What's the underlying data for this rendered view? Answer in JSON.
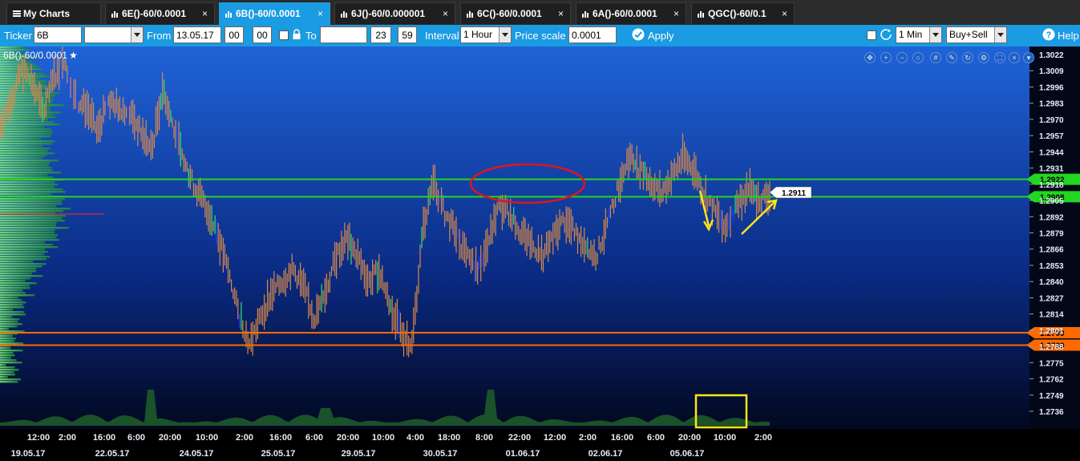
{
  "tabs": [
    {
      "label": "My Charts",
      "active": false
    },
    {
      "label": "6E()-60/0.0001",
      "active": false
    },
    {
      "label": "6B()-60/0.0001",
      "active": true
    },
    {
      "label": "6J()-60/0.000001",
      "active": false
    },
    {
      "label": "6C()-60/0.0001",
      "active": false
    },
    {
      "label": "6A()-60/0.0001",
      "active": false
    },
    {
      "label": "QGC()-60/0.1",
      "active": false
    }
  ],
  "tab_close_glyph": "×",
  "toolbar": {
    "ticker_label": "Ticker",
    "ticker_value": "6B",
    "from_label": "From",
    "from_date": "13.05.17",
    "from_hour": "00",
    "from_min": "00",
    "to_label": "To",
    "to_date": "",
    "to_hour": "23",
    "to_min": "59",
    "interval_label": "Interval",
    "interval_value": "1 Hour",
    "price_scale_label": "Price scale",
    "price_scale_value": "0.0001",
    "apply_label": "Apply",
    "period_value": "1 Min",
    "mode_value": "Buy+Sell",
    "help_label": "Help"
  },
  "chart_title": "6B()-60/0.0001",
  "chart_title_star": "★",
  "colors": {
    "accent": "#1a9be2",
    "bar": "#d98a4a",
    "green_level": "#22d622",
    "orange_level": "#ff6a00",
    "annotation_red": "#e0141e",
    "annotation_yellow": "#ffe516"
  },
  "chart_data": {
    "type": "bar",
    "y_ticks": [
      "1.3022",
      "1.3009",
      "1.2996",
      "1.2983",
      "1.2970",
      "1.2957",
      "1.2944",
      "1.2931",
      "1.2918",
      "1.2905",
      "1.2892",
      "1.2879",
      "1.2866",
      "1.2853",
      "1.2840",
      "1.2827",
      "1.2814",
      "1.2801",
      "1.2788",
      "1.2775",
      "1.2762",
      "1.2749",
      "1.2736"
    ],
    "ylim": [
      1.2726,
      1.3025
    ],
    "x_time_labels": [
      "12:00",
      "2:00",
      "16:00",
      "6:00",
      "20:00",
      "10:00",
      "2:00",
      "16:00",
      "6:00",
      "20:00",
      "10:00",
      "4:00",
      "18:00",
      "8:00",
      "22:00",
      "12:00",
      "2:00",
      "16:00",
      "6:00",
      "20:00",
      "10:00",
      "2:00"
    ],
    "x_date_labels": [
      "19.05.17",
      "22.05.17",
      "24.05.17",
      "25.05.17",
      "29.05.17",
      "30.05.17",
      "01.06.17",
      "02.06.17",
      "05.06.17"
    ],
    "price_levels": [
      {
        "label": "1.2922",
        "value": 1.2922,
        "color": "green"
      },
      {
        "label": "1.2908",
        "value": 1.2908,
        "color": "green"
      },
      {
        "label": "1.2799",
        "value": 1.2799,
        "color": "orange"
      },
      {
        "label": "1.2789",
        "value": 1.2789,
        "color": "orange"
      }
    ],
    "last_price": "1.2911",
    "close_path": [
      [
        1,
        1.2965
      ],
      [
        2,
        1.2985
      ],
      [
        3,
        1.301
      ],
      [
        4,
        1.3
      ],
      [
        5,
        1.2975
      ],
      [
        6,
        1.3005
      ],
      [
        7,
        1.3015
      ],
      [
        8,
        1.2985
      ],
      [
        9,
        1.298
      ],
      [
        10,
        1.296
      ],
      [
        11,
        1.2985
      ],
      [
        12,
        1.298
      ],
      [
        13,
        1.2975
      ],
      [
        14,
        1.296
      ],
      [
        15,
        1.2945
      ],
      [
        16,
        1.2995
      ],
      [
        17,
        1.2965
      ],
      [
        18,
        1.2935
      ],
      [
        19,
        1.2915
      ],
      [
        20,
        1.29
      ],
      [
        21,
        1.288
      ],
      [
        22,
        1.285
      ],
      [
        23,
        1.2815
      ],
      [
        24,
        1.279
      ],
      [
        25,
        1.281
      ],
      [
        26,
        1.283
      ],
      [
        27,
        1.284
      ],
      [
        28,
        1.285
      ],
      [
        29,
        1.2835
      ],
      [
        30,
        1.281
      ],
      [
        31,
        1.283
      ],
      [
        32,
        1.286
      ],
      [
        33,
        1.2875
      ],
      [
        34,
        1.286
      ],
      [
        35,
        1.284
      ],
      [
        36,
        1.285
      ],
      [
        37,
        1.282
      ],
      [
        38,
        1.28
      ],
      [
        39,
        1.279
      ],
      [
        40,
        1.288
      ],
      [
        41,
        1.292
      ],
      [
        42,
        1.2895
      ],
      [
        43,
        1.288
      ],
      [
        44,
        1.286
      ],
      [
        45,
        1.285
      ],
      [
        46,
        1.287
      ],
      [
        47,
        1.29
      ],
      [
        48,
        1.2895
      ],
      [
        49,
        1.288
      ],
      [
        50,
        1.287
      ],
      [
        51,
        1.286
      ],
      [
        52,
        1.2875
      ],
      [
        53,
        1.289
      ],
      [
        54,
        1.288
      ],
      [
        55,
        1.287
      ],
      [
        56,
        1.286
      ],
      [
        57,
        1.2885
      ],
      [
        58,
        1.2915
      ],
      [
        59,
        1.294
      ],
      [
        60,
        1.293
      ],
      [
        61,
        1.292
      ],
      [
        62,
        1.291
      ],
      [
        63,
        1.2925
      ],
      [
        64,
        1.294
      ],
      [
        65,
        1.293
      ],
      [
        66,
        1.291
      ],
      [
        67,
        1.2895
      ],
      [
        68,
        1.2885
      ],
      [
        69,
        1.29
      ],
      [
        70,
        1.2915
      ],
      [
        71,
        1.2905
      ],
      [
        72,
        1.291
      ]
    ]
  }
}
